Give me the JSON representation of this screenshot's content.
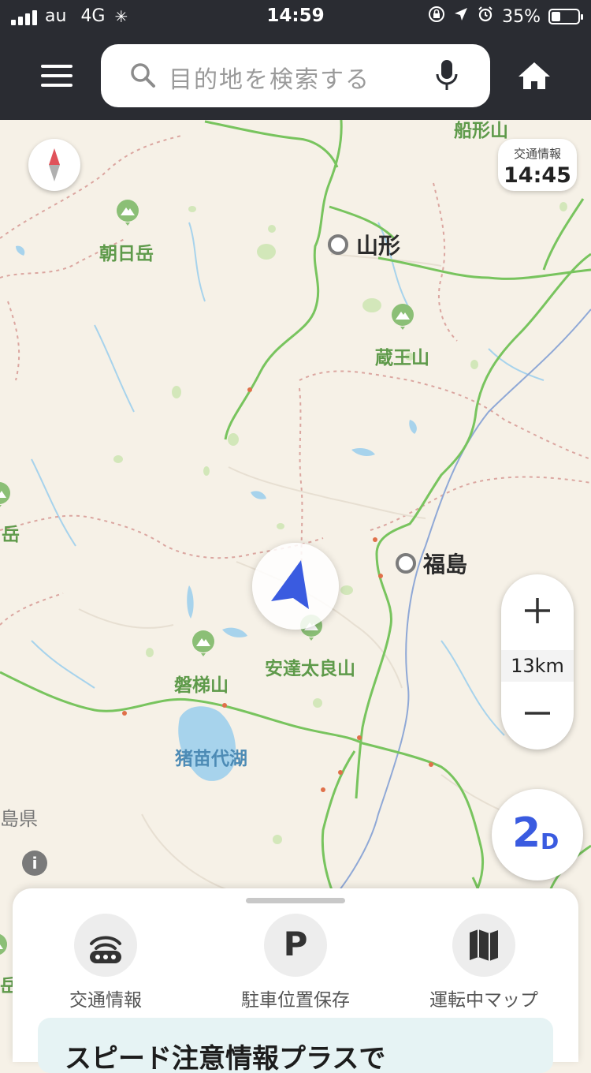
{
  "status_bar": {
    "carrier": "au",
    "network": "4G",
    "time": "14:59",
    "battery": "35%",
    "battery_level": 0.35
  },
  "header": {
    "search_placeholder": "目的地を検索する"
  },
  "map": {
    "labels": {
      "funagata": "船形山",
      "asahidake": "朝日岳",
      "yamagata": "山形",
      "zaosan": "蔵王山",
      "dake_left": "岳",
      "fukushima": "福島",
      "adatara": "安達太良山",
      "bandaisan": "磐梯山",
      "inawashiro": "猪苗代湖",
      "shimaken": "島県",
      "dake_left_bottom": "岳"
    },
    "traffic_info": {
      "title": "交通情報",
      "time": "14:45"
    },
    "scale": "13km",
    "view_mode": {
      "big": "2",
      "small": "D"
    },
    "info_label": "i"
  },
  "sheet": {
    "items": [
      {
        "label": "交通情報"
      },
      {
        "label": "駐車位置保存",
        "icon_text": "P"
      },
      {
        "label": "運転中マップ"
      }
    ],
    "promo_text": "スピード注意情報プラスで"
  },
  "colors": {
    "header_bg": "#2a2c32",
    "accent_blue": "#3a5be0",
    "road_green": "#71c35a",
    "map_bg": "#f6f1e7"
  }
}
